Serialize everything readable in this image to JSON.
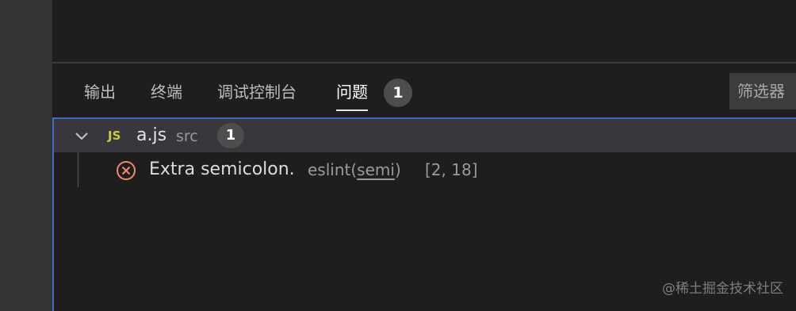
{
  "panel": {
    "tabs": [
      {
        "label": "输出"
      },
      {
        "label": "终端"
      },
      {
        "label": "调试控制台"
      },
      {
        "label": "问题",
        "active": true
      }
    ],
    "problems_count": "1",
    "filter_placeholder": "筛选器"
  },
  "problems": {
    "file": {
      "icon_name": "javascript-icon",
      "icon_text": "JS",
      "name": "a.js",
      "dir": "src",
      "count": "1"
    },
    "items": [
      {
        "severity_icon": "error-circle-icon",
        "message": "Extra semicolon.",
        "source_prefix": "eslint(",
        "code": "semi",
        "source_suffix": ")",
        "position": "[2, 18]"
      }
    ]
  },
  "watermark": "@稀土掘金技术社区",
  "colors": {
    "focus_border": "#3f67c6",
    "error": "#f48771",
    "js_icon": "#cbcb41",
    "badge_bg": "#4d4d4d"
  }
}
